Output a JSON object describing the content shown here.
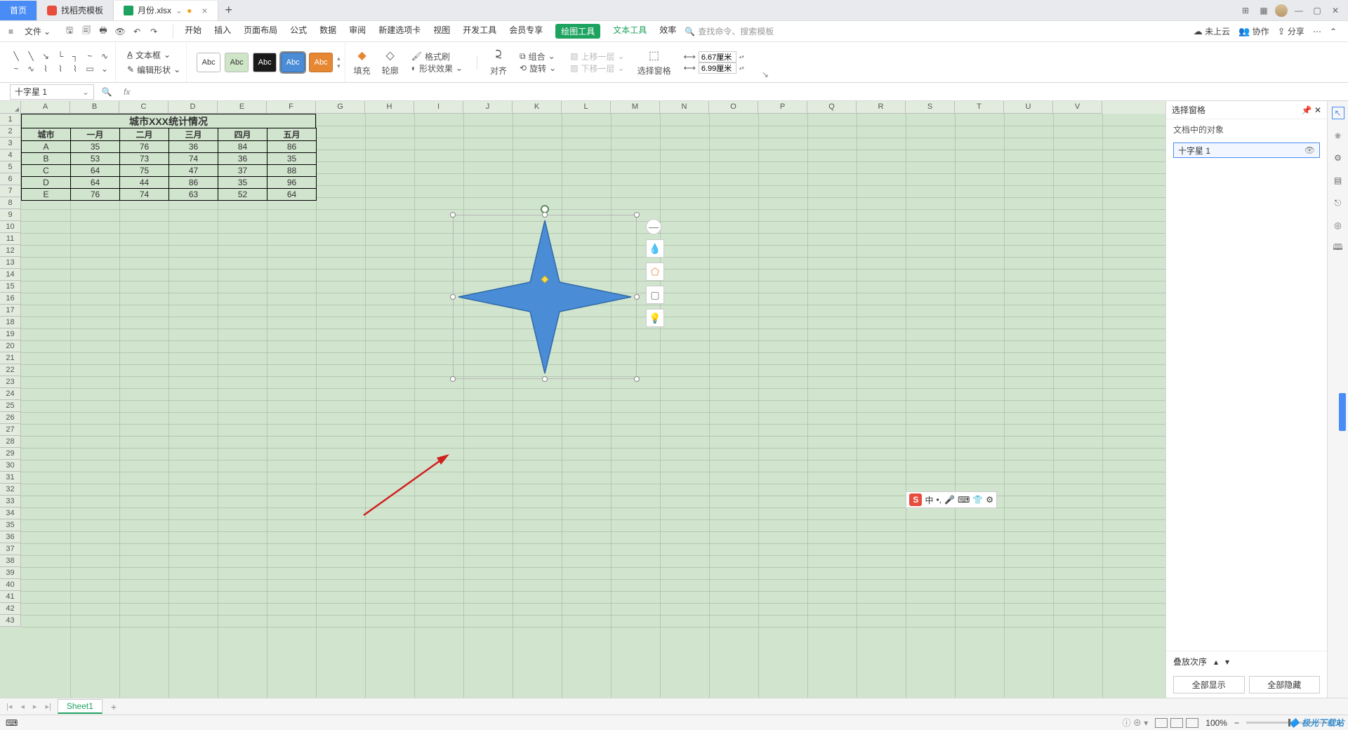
{
  "titlebar": {
    "home": "首页",
    "template_tab": "找稻壳模板",
    "doc_tab": "月份.xlsx"
  },
  "menu": {
    "file": "文件",
    "tabs": [
      "开始",
      "插入",
      "页面布局",
      "公式",
      "数据",
      "审阅",
      "新建选项卡",
      "视图",
      "开发工具",
      "会员专享"
    ],
    "drawing_tools": "绘图工具",
    "text_tools": "文本工具",
    "efficiency": "效率",
    "search_placeholder": "查找命令、搜索模板",
    "cloud": "未上云",
    "coop": "协作",
    "share": "分享"
  },
  "ribbon": {
    "textbox": "文本框",
    "edit_shape": "编辑形状",
    "abc": "Abc",
    "fill": "填充",
    "outline": "轮廓",
    "format_brush": "格式刷",
    "shape_effect": "形状效果",
    "align": "对齐",
    "group": "组合",
    "rotate": "旋转",
    "bring_fwd": "上移一层",
    "send_back": "下移一层",
    "sel_pane": "选择窗格",
    "width_val": "6.67厘米",
    "height_val": "6.99厘米"
  },
  "namebox": "十字星 1",
  "columns": [
    "A",
    "B",
    "C",
    "D",
    "E",
    "F",
    "G",
    "H",
    "I",
    "J",
    "K",
    "L",
    "M",
    "N",
    "O",
    "P",
    "Q",
    "R",
    "S",
    "T",
    "U",
    "V"
  ],
  "table": {
    "title": "城市XXX统计情况",
    "headers": [
      "城市",
      "一月",
      "二月",
      "三月",
      "四月",
      "五月"
    ],
    "rows": [
      [
        "A",
        "35",
        "76",
        "36",
        "84",
        "86"
      ],
      [
        "B",
        "53",
        "73",
        "74",
        "36",
        "35"
      ],
      [
        "C",
        "64",
        "75",
        "47",
        "37",
        "88"
      ],
      [
        "D",
        "64",
        "44",
        "86",
        "35",
        "96"
      ],
      [
        "E",
        "76",
        "74",
        "63",
        "52",
        "64"
      ]
    ]
  },
  "panel": {
    "title": "选择窗格",
    "subtitle": "文档中的对象",
    "item": "十字星 1",
    "stack_order": "叠放次序",
    "show_all": "全部显示",
    "hide_all": "全部隐藏"
  },
  "sheet": {
    "name": "Sheet1"
  },
  "status": {
    "zoom": "100%"
  },
  "ime": {
    "lang": "中"
  },
  "watermark": "极光下载站"
}
